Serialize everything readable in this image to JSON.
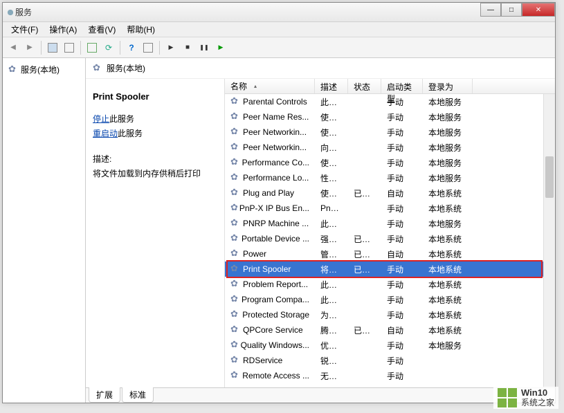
{
  "window": {
    "title": "服务"
  },
  "menubar": {
    "file": "文件(F)",
    "action": "操作(A)",
    "view": "查看(V)",
    "help": "帮助(H)"
  },
  "left": {
    "root": "服务(本地)"
  },
  "right_header": {
    "label": "服务(本地)"
  },
  "detail": {
    "title": "Print Spooler",
    "stop_prefix": "停止",
    "stop_suffix": "此服务",
    "restart_prefix": "重启动",
    "restart_suffix": "此服务",
    "desc_label": "描述:",
    "desc_text": "将文件加载到内存供稍后打印"
  },
  "columns": {
    "name": "名称",
    "desc": "描述",
    "status": "状态",
    "startup": "启动类型",
    "logon": "登录为"
  },
  "services": [
    {
      "name": "Parental Controls",
      "desc": "此服...",
      "status": "",
      "startup": "手动",
      "logon": "本地服务"
    },
    {
      "name": "Peer Name Res...",
      "desc": "使用...",
      "status": "",
      "startup": "手动",
      "logon": "本地服务"
    },
    {
      "name": "Peer Networkin...",
      "desc": "使用...",
      "status": "",
      "startup": "手动",
      "logon": "本地服务"
    },
    {
      "name": "Peer Networkin...",
      "desc": "向对...",
      "status": "",
      "startup": "手动",
      "logon": "本地服务"
    },
    {
      "name": "Performance Co...",
      "desc": "使远...",
      "status": "",
      "startup": "手动",
      "logon": "本地服务"
    },
    {
      "name": "Performance Lo...",
      "desc": "性能...",
      "status": "",
      "startup": "手动",
      "logon": "本地服务"
    },
    {
      "name": "Plug and Play",
      "desc": "使计...",
      "status": "已启动",
      "startup": "自动",
      "logon": "本地系统"
    },
    {
      "name": "PnP-X IP Bus En...",
      "desc": "PnP-...",
      "status": "",
      "startup": "手动",
      "logon": "本地系统"
    },
    {
      "name": "PNRP Machine ...",
      "desc": "此服...",
      "status": "",
      "startup": "手动",
      "logon": "本地服务"
    },
    {
      "name": "Portable Device ...",
      "desc": "强制...",
      "status": "已启动",
      "startup": "手动",
      "logon": "本地系统"
    },
    {
      "name": "Power",
      "desc": "管理...",
      "status": "已启动",
      "startup": "自动",
      "logon": "本地系统"
    },
    {
      "name": "Print Spooler",
      "desc": "将文...",
      "status": "已启动",
      "startup": "手动",
      "logon": "本地系统",
      "selected": true
    },
    {
      "name": "Problem Report...",
      "desc": "此服...",
      "status": "",
      "startup": "手动",
      "logon": "本地系统"
    },
    {
      "name": "Program Compa...",
      "desc": "此服...",
      "status": "",
      "startup": "手动",
      "logon": "本地系统"
    },
    {
      "name": "Protected Storage",
      "desc": "为敏...",
      "status": "",
      "startup": "手动",
      "logon": "本地系统"
    },
    {
      "name": "QPCore Service",
      "desc": "腾讯...",
      "status": "已启动",
      "startup": "自动",
      "logon": "本地系统"
    },
    {
      "name": "Quality Windows...",
      "desc": "优质...",
      "status": "",
      "startup": "手动",
      "logon": "本地服务"
    },
    {
      "name": "RDService",
      "desc": "锐动...",
      "status": "",
      "startup": "手动",
      "logon": ""
    },
    {
      "name": "Remote Access ...",
      "desc": "无论...",
      "status": "",
      "startup": "手动",
      "logon": ""
    }
  ],
  "tabs": {
    "extended": "扩展",
    "standard": "标准"
  },
  "watermark": {
    "brand": "Win10",
    "sub": "系统之家"
  }
}
